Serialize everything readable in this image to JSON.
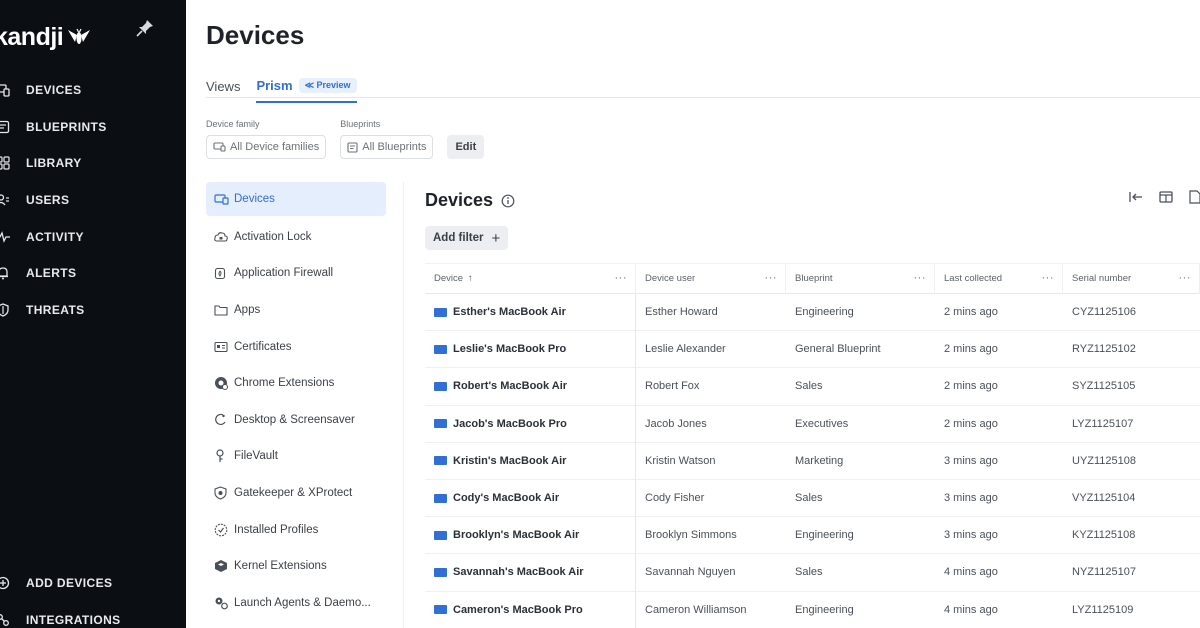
{
  "app": {
    "brand": "kandji",
    "accent": "#2f6fd6",
    "sidebar_bg": "#0b0f14"
  },
  "sidebar": {
    "items": [
      {
        "label": "DEVICES",
        "icon": "devices-icon"
      },
      {
        "label": "BLUEPRINTS",
        "icon": "blueprints-icon"
      },
      {
        "label": "LIBRARY",
        "icon": "library-icon"
      },
      {
        "label": "USERS",
        "icon": "users-icon"
      },
      {
        "label": "ACTIVITY",
        "icon": "activity-icon"
      },
      {
        "label": "ALERTS",
        "icon": "bell-icon"
      },
      {
        "label": "THREATS",
        "icon": "shield-icon"
      }
    ],
    "bottom": [
      {
        "label": "ADD DEVICES",
        "icon": "add-circle-icon"
      },
      {
        "label": "INTEGRATIONS",
        "icon": "integrations-icon"
      }
    ]
  },
  "header": {
    "title": "Devices",
    "tabs": [
      {
        "label": "Views"
      },
      {
        "label": "Prism",
        "badge": "Preview"
      }
    ]
  },
  "filters": {
    "device_family_label": "Device family",
    "device_family_value": "All Device families",
    "blueprints_label": "Blueprints",
    "blueprints_value": "All Blueprints",
    "edit_label": "Edit"
  },
  "subnav": [
    {
      "label": "Devices",
      "icon": "laptop-icon"
    },
    {
      "label": "Activation Lock",
      "icon": "lock-cloud-icon"
    },
    {
      "label": "Application Firewall",
      "icon": "firewall-icon"
    },
    {
      "label": "Apps",
      "icon": "folder-icon"
    },
    {
      "label": "Certificates",
      "icon": "certificate-icon"
    },
    {
      "label": "Chrome Extensions",
      "icon": "chrome-icon"
    },
    {
      "label": "Desktop & Screensaver",
      "icon": "screensaver-icon"
    },
    {
      "label": "FileVault",
      "icon": "key-icon"
    },
    {
      "label": "Gatekeeper & XProtect",
      "icon": "gatekeeper-icon"
    },
    {
      "label": "Installed Profiles",
      "icon": "check-circle-icon"
    },
    {
      "label": "Kernel Extensions",
      "icon": "kernel-icon"
    },
    {
      "label": "Launch Agents & Daemo...",
      "icon": "gears-icon"
    }
  ],
  "content": {
    "title": "Devices",
    "add_filter_label": "Add filter",
    "columns": [
      "Device",
      "Device user",
      "Blueprint",
      "Last collected",
      "Serial number"
    ],
    "rows": [
      {
        "device": "Esther's MacBook Air",
        "user": "Esther Howard",
        "blueprint": "Engineering",
        "last": "2 mins ago",
        "serial": "CYZ1125106"
      },
      {
        "device": "Leslie's MacBook Pro",
        "user": "Leslie Alexander",
        "blueprint": "General Blueprint",
        "last": "2 mins ago",
        "serial": "RYZ1125102"
      },
      {
        "device": "Robert's MacBook Air",
        "user": "Robert Fox",
        "blueprint": "Sales",
        "last": "2 mins ago",
        "serial": "SYZ1125105"
      },
      {
        "device": "Jacob's MacBook Pro",
        "user": "Jacob Jones",
        "blueprint": "Executives",
        "last": "2 mins ago",
        "serial": "LYZ1125107"
      },
      {
        "device": "Kristin's MacBook Air",
        "user": "Kristin Watson",
        "blueprint": "Marketing",
        "last": "3 mins ago",
        "serial": "UYZ1125108"
      },
      {
        "device": "Cody's MacBook Air",
        "user": "Cody Fisher",
        "blueprint": "Sales",
        "last": "3 mins ago",
        "serial": "VYZ1125104"
      },
      {
        "device": "Brooklyn's MacBook Air",
        "user": "Brooklyn Simmons",
        "blueprint": "Engineering",
        "last": "3 mins ago",
        "serial": "KYZ1125108"
      },
      {
        "device": "Savannah's MacBook Air",
        "user": "Savannah Nguyen",
        "blueprint": "Sales",
        "last": "4 mins ago",
        "serial": "NYZ1125107"
      },
      {
        "device": "Cameron's MacBook Pro",
        "user": "Cameron Williamson",
        "blueprint": "Engineering",
        "last": "4 mins ago",
        "serial": "LYZ1125109"
      }
    ]
  }
}
